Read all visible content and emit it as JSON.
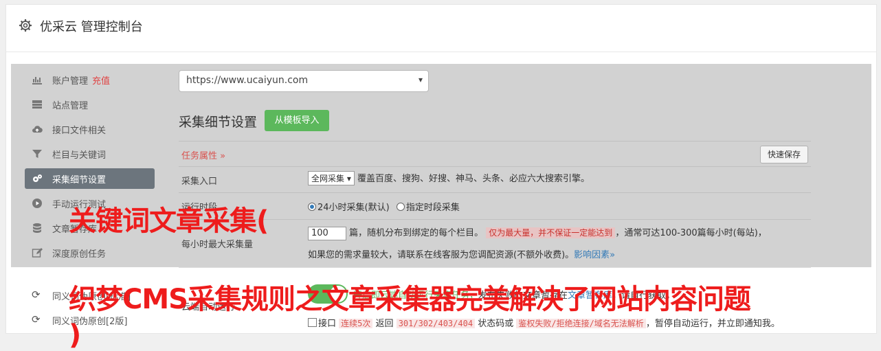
{
  "header": {
    "title": "优采云 管理控制台",
    "icon": "gear-icon"
  },
  "sidebar": {
    "items": [
      {
        "label": "账户管理",
        "extra": "充值",
        "icon": "bar-chart-icon"
      },
      {
        "label": "站点管理",
        "icon": "server-icon"
      },
      {
        "label": "接口文件相关",
        "icon": "cloud-upload-icon"
      },
      {
        "label": "栏目与关键词",
        "icon": "filter-icon"
      },
      {
        "label": "采集细节设置",
        "icon": "gears-icon",
        "active": true
      },
      {
        "label": "手动运行测试",
        "icon": "play-circle-icon"
      },
      {
        "label": "文章暂存库",
        "icon": "database-icon"
      },
      {
        "label": "深度原创任务",
        "icon": "edit-icon"
      },
      {
        "label": "同义词伪原创[标准]",
        "icon": "refresh-icon"
      },
      {
        "label": "同义词伪原创[2版]",
        "icon": "refresh-icon"
      }
    ]
  },
  "site_select": {
    "value": "https://www.ucaiyun.com"
  },
  "section": {
    "title": "采集细节设置",
    "import_button": "从模板导入"
  },
  "task_bar": {
    "label": "任务属性 »",
    "quick_save": "快速保存"
  },
  "rows": {
    "entry": {
      "label": "采集入口",
      "select": "全网采集",
      "desc": "覆盖百度、搜狗、好搜、神马、头条、必应六大搜索引擎。"
    },
    "runtime": {
      "label": "运行时段",
      "opt1": "24小时采集(默认)",
      "opt2": "指定时段采集"
    },
    "max": {
      "label": "每小时最大采集量",
      "value": "100",
      "text1": "篇，随机分布到绑定的每个栏目。",
      "warn": "仅为最大量，并不保证一定能达到",
      "text2": "，通常可达100-300篇每小时(每站)，",
      "text3": "如果您的需求量较大，请联系在线客服为您调配资源(不额外收费)。",
      "link": "影响因素»"
    },
    "cloud": {
      "label": "云端自动运行",
      "text_a": "开启即云端自动运行采集任务，",
      "text_b": "发布失败的文章暂存在",
      "link": "文章暂存库",
      "text_c": "，请自行获取。"
    },
    "interface": {
      "label": "接口",
      "tag1": "连续5次",
      "text1": "返回",
      "tag2": "301/302/403/404",
      "text2": "状态码或",
      "tag3": "鉴权失败/拒绝连接/域名无法解析",
      "text3": "，暂停自动运行，并立即通知我。"
    }
  },
  "overlay": {
    "line1": "关键词文章采集(",
    "line2": "织梦CMS采集规则之文章采集器完美解决了网站内容问题",
    "line3": ")"
  },
  "colors": {
    "active_nav": "#6c757d",
    "green": "#5cb85c",
    "red": "#ee1c1c",
    "panel": "#d2d2d2"
  }
}
